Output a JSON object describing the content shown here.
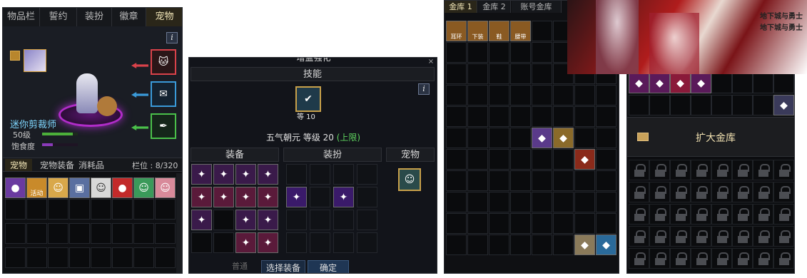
{
  "colors": {
    "panel_bg": "#0f1013",
    "tab_active": "#f2e6b8",
    "arrow_red": "#d9424a",
    "arrow_blue": "#3a9ad9",
    "arrow_green": "#4ac04a",
    "skill_green": "#5fd35f",
    "level_bar_green": "#4caf3a",
    "satiety_bar_purple": "#8a3ab9"
  },
  "pet_panel": {
    "tabs": [
      "物品栏",
      "誓约",
      "装扮",
      "徽章",
      "宠物"
    ],
    "active_tab": "宠物",
    "info_icon": "i",
    "pet_name": "迷你剪裁师",
    "level_label": "50级",
    "satiety_label": "饱食度",
    "level_progress": 0.85,
    "satiety_progress": 0.3,
    "sub_tabs": [
      "宠物",
      "宠物装备",
      "消耗品"
    ],
    "slot_label": "栏位 : 8/320",
    "items_badge": "活动"
  },
  "enhance_panel": {
    "window_title": "增益强化",
    "skill_section": "技能",
    "skill_icon_level": "等 10",
    "info_icon": "i",
    "skill_text": "五气朝元 等级 20",
    "skill_limit": "(上限)",
    "col_equip": "装备",
    "col_costume": "装扮",
    "col_pet": "宠物",
    "btn_select": "选择装备",
    "btn_confirm": "确定",
    "footer_partial": "普通"
  },
  "bank_panel": {
    "tabs": [
      "金库 1",
      "金库 2",
      "账号金库"
    ],
    "active_tab": "金库 1",
    "item_labels": [
      "耳环",
      "下装",
      "鞋",
      "腰带"
    ]
  },
  "account_panel": {
    "expand_button": "扩大金库",
    "banner_text_1": "地下城与勇士",
    "banner_text_2": "地下城与勇士"
  }
}
